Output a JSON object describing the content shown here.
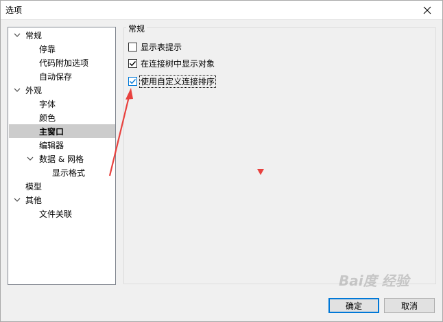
{
  "window": {
    "title": "选项",
    "close_glyph": "✕"
  },
  "tree": {
    "items": [
      {
        "label": "常规",
        "level": 0,
        "expanded": true,
        "selected": false
      },
      {
        "label": "停靠",
        "level": 1,
        "selected": false
      },
      {
        "label": "代码附加选项",
        "level": 1,
        "selected": false
      },
      {
        "label": "自动保存",
        "level": 1,
        "selected": false
      },
      {
        "label": "外观",
        "level": 0,
        "expanded": true,
        "selected": false
      },
      {
        "label": "字体",
        "level": 1,
        "selected": false
      },
      {
        "label": "颜色",
        "level": 1,
        "selected": false
      },
      {
        "label": "主窗口",
        "level": 1,
        "selected": true
      },
      {
        "label": "编辑器",
        "level": 1,
        "selected": false
      },
      {
        "label": "数据 & 网格",
        "level": 1,
        "expanded": true,
        "selected": false
      },
      {
        "label": "显示格式",
        "level": 2,
        "selected": false
      },
      {
        "label": "模型",
        "level": 0,
        "selected": false
      },
      {
        "label": "其他",
        "level": 0,
        "expanded": true,
        "selected": false
      },
      {
        "label": "文件关联",
        "level": 1,
        "selected": false
      }
    ]
  },
  "panel": {
    "group_title": "常规",
    "options": [
      {
        "label": "显示表提示",
        "checked": false
      },
      {
        "label": "在连接树中显示对象",
        "checked": true
      },
      {
        "label": "使用自定义连接排序",
        "checked": true,
        "focused": true
      }
    ]
  },
  "buttons": {
    "ok": "确定",
    "cancel": "取消"
  },
  "annotation": {
    "color": "#e8413e"
  },
  "watermark": "Bai度 经验"
}
